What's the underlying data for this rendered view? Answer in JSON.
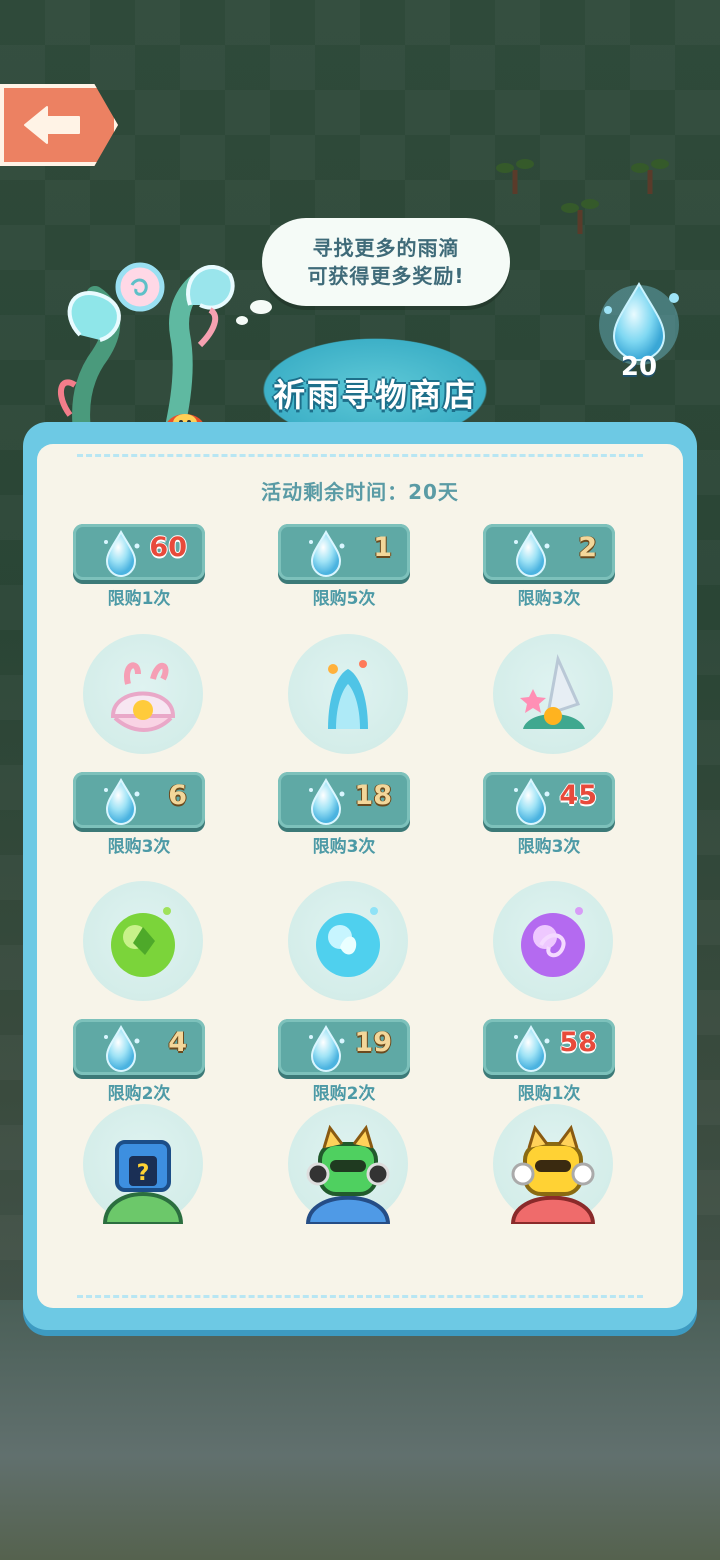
{
  "bubble": {
    "line1": "寻找更多的雨滴",
    "line2": "可获得更多奖励!"
  },
  "drop_counter": {
    "value": "20"
  },
  "shop": {
    "title": "祈雨寻物商店",
    "remaining_label": "活动剩余时间：20天"
  },
  "items": [
    {
      "price": "60",
      "limit": "限购1次",
      "icon": "partial-item-icon"
    },
    {
      "price": "1",
      "limit": "限购5次",
      "icon": "partial-item-icon"
    },
    {
      "price": "2",
      "limit": "限购3次",
      "icon": "partial-item-icon"
    },
    {
      "price": "6",
      "limit": "限购3次",
      "icon": "shell-coral-icon"
    },
    {
      "price": "18",
      "limit": "限购3次",
      "icon": "water-fountain-icon"
    },
    {
      "price": "45",
      "limit": "限购3次",
      "icon": "seashell-rock-icon"
    },
    {
      "price": "4",
      "limit": "限购2次",
      "icon": "green-orb-icon"
    },
    {
      "price": "19",
      "limit": "限购2次",
      "icon": "cyan-orb-icon"
    },
    {
      "price": "58",
      "limit": "限购1次",
      "icon": "purple-orb-icon"
    },
    {
      "price": "",
      "limit": "",
      "icon": "mystery-bag-icon"
    },
    {
      "price": "",
      "limit": "",
      "icon": "green-cat-robot-icon"
    },
    {
      "price": "",
      "limit": "",
      "icon": "yellow-cat-robot-icon"
    }
  ],
  "colors": {
    "price_high": "#e84a3b",
    "price_normal": "#f3d79a",
    "panel": "#6dc9e4"
  }
}
